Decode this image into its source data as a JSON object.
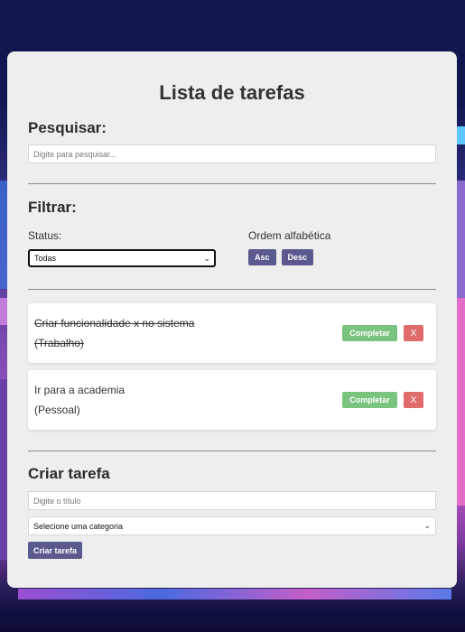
{
  "title": "Lista de tarefas",
  "search": {
    "heading": "Pesquisar:",
    "placeholder": "Digite para pesquisar..."
  },
  "filter": {
    "heading": "Filtrar:",
    "status_label": "Status:",
    "status_value": "Todas",
    "sort_label": "Ordem alfabética",
    "asc_label": "Asc",
    "desc_label": "Desc"
  },
  "todos": [
    {
      "text": "Criar funcionalidade x no sistema",
      "category": "(Trabalho)",
      "completed": true,
      "complete_label": "Completar",
      "remove_label": "X"
    },
    {
      "text": "Ir para a academia",
      "category": "(Pessoal)",
      "completed": false,
      "complete_label": "Completar",
      "remove_label": "X"
    }
  ],
  "create": {
    "heading": "Criar tarefa",
    "title_placeholder": "Digite o título",
    "category_value": "Selecione uma categoria",
    "submit_label": "Criar tarefa"
  },
  "icons": {
    "status_chevron": "chevron-down-icon",
    "category_chevron": "chevron-down-icon"
  },
  "colors": {
    "card_bg": "#eeeeee",
    "sort_buttons": "#5a5a8e",
    "complete_button": "#7bc47f",
    "remove_button": "#e06b6b",
    "create_button": "#5a5a8e"
  }
}
